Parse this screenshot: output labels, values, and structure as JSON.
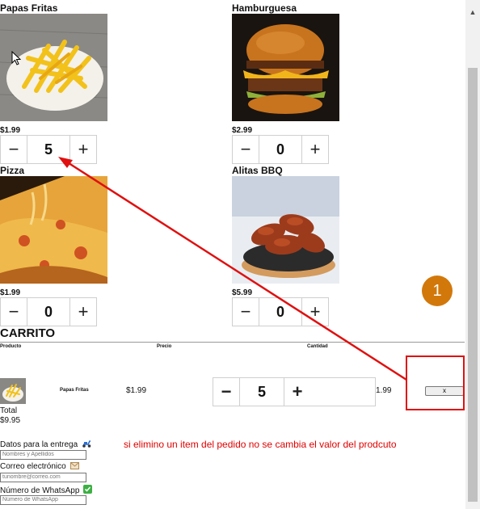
{
  "products": [
    {
      "name": "Papas Fritas",
      "price": "$1.99",
      "quantity": "5",
      "image_icon": "fries-photo"
    },
    {
      "name": "Hamburguesa",
      "price": "$2.99",
      "quantity": "0",
      "image_icon": "burger-photo"
    },
    {
      "name": "Pizza",
      "price": "$1.99",
      "quantity": "0",
      "image_icon": "pizza-photo"
    },
    {
      "name": "Alitas BBQ",
      "price": "$5.99",
      "quantity": "0",
      "image_icon": "wings-photo"
    }
  ],
  "stepper": {
    "minus": "−",
    "plus": "+"
  },
  "cart": {
    "title": "CARRITO",
    "headers": {
      "product": "Producto",
      "price": "Precio",
      "quantity": "Cantidad"
    },
    "row": {
      "name": "Papas Fritas",
      "price": "$1.99",
      "quantity": "5",
      "subtotal": "1.99",
      "remove_label": "x"
    },
    "total_label": "Total",
    "total_value": "$9.95"
  },
  "form": {
    "title": "Datos para la entrega",
    "name_placeholder": "Nombres y Apellidos",
    "email_label": "Correo electrónico",
    "email_placeholder": "tunombre@correo.com",
    "whatsapp_label": "Número de WhatsApp",
    "whatsapp_placeholder": "Número de WhatsApp"
  },
  "annotation": {
    "badge": "1",
    "note": "si elimino un item del pedido no se cambia el valor del prodcuto",
    "color": "#e01010"
  },
  "colors": {
    "badge": "#d2780a",
    "scroll_thumb": "#c1c1c1"
  }
}
